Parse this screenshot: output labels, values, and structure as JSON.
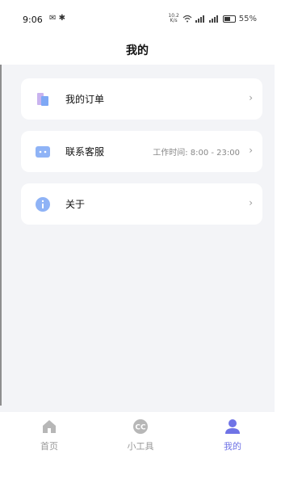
{
  "status_bar": {
    "time": "9:06",
    "left_icons": [
      "notification-icon",
      "bluetooth-icon"
    ],
    "speed_top": "10.2",
    "speed_bottom": "K/s",
    "battery": "55%"
  },
  "header": {
    "title": "我的"
  },
  "menu": {
    "items": [
      {
        "label": "我的订单",
        "note": "",
        "icon": "orders-icon"
      },
      {
        "label": "联系客服",
        "note": "工作时间: 8:00 - 23:00",
        "icon": "customer-service-icon"
      },
      {
        "label": "关于",
        "note": "",
        "icon": "info-icon"
      }
    ]
  },
  "tabbar": {
    "tabs": [
      {
        "label": "首页",
        "icon": "home-icon",
        "active": false
      },
      {
        "label": "小工具",
        "icon": "cc-icon",
        "active": false
      },
      {
        "label": "我的",
        "icon": "user-icon",
        "active": true
      }
    ]
  },
  "colors": {
    "accent": "#6f73e6",
    "background": "#f3f4f7",
    "card": "#ffffff"
  }
}
